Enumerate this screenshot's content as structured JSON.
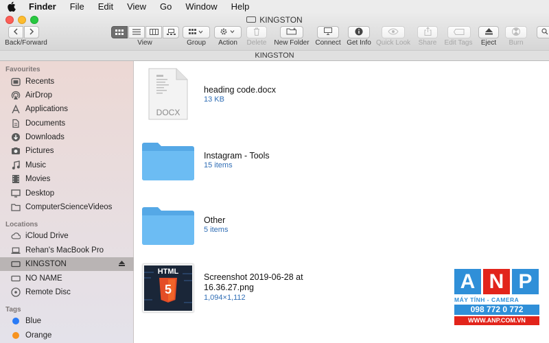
{
  "menubar": {
    "app_name": "Finder",
    "items": [
      "File",
      "Edit",
      "View",
      "Go",
      "Window",
      "Help"
    ]
  },
  "window": {
    "title": "KINGSTON",
    "path_title": "KINGSTON"
  },
  "toolbar": {
    "back_forward_label": "Back/Forward",
    "view_label": "View",
    "group_label": "Group",
    "action_label": "Action",
    "delete_label": "Delete",
    "new_folder_label": "New Folder",
    "connect_label": "Connect",
    "get_info_label": "Get Info",
    "quick_look_label": "Quick Look",
    "share_label": "Share",
    "edit_tags_label": "Edit Tags",
    "eject_label": "Eject",
    "burn_label": "Burn",
    "view_mode_selected": "icon"
  },
  "sidebar": {
    "favourites_header": "Favourites",
    "favourites": [
      {
        "label": "Recents",
        "icon": "recents-icon"
      },
      {
        "label": "AirDrop",
        "icon": "airdrop-icon"
      },
      {
        "label": "Applications",
        "icon": "applications-icon"
      },
      {
        "label": "Documents",
        "icon": "documents-icon"
      },
      {
        "label": "Downloads",
        "icon": "downloads-icon"
      },
      {
        "label": "Pictures",
        "icon": "pictures-icon"
      },
      {
        "label": "Music",
        "icon": "music-icon"
      },
      {
        "label": "Movies",
        "icon": "movies-icon"
      },
      {
        "label": "Desktop",
        "icon": "desktop-icon"
      },
      {
        "label": "ComputerScienceVideos",
        "icon": "folder-icon"
      }
    ],
    "locations_header": "Locations",
    "locations": [
      {
        "label": "iCloud Drive",
        "icon": "cloud-icon"
      },
      {
        "label": "Rehan's MacBook Pro",
        "icon": "laptop-icon"
      },
      {
        "label": "KINGSTON",
        "icon": "drive-icon",
        "selected": true
      },
      {
        "label": "NO NAME",
        "icon": "drive-icon"
      },
      {
        "label": "Remote Disc",
        "icon": "disc-icon"
      }
    ],
    "tags_header": "Tags",
    "tags": [
      {
        "label": "Blue",
        "color": "#2a7bf6"
      },
      {
        "label": "Orange",
        "color": "#f7931e"
      }
    ]
  },
  "files": [
    {
      "name": "heading code.docx",
      "meta": "13 KB",
      "type": "docx",
      "icon_label": "DOCX"
    },
    {
      "name": "Instagram - Tools",
      "meta": "15 items",
      "type": "folder"
    },
    {
      "name": "Other",
      "meta": "5 items",
      "type": "folder"
    },
    {
      "name_line1": "Screenshot 2019-06-28 at",
      "name_line2": "16.36.27.png",
      "meta": "1,094×1,112",
      "type": "png",
      "thumb_label": "HTML",
      "thumb_badge": "5"
    }
  ],
  "watermark": {
    "letters": [
      "A",
      "N",
      "P"
    ],
    "subtitle": "MÁY TÍNH - CAMERA",
    "phone": "098 772 0 772",
    "website": "WWW.ANP.COM.VN"
  },
  "colors": {
    "accent_blue": "#2f6db5",
    "folder_blue": "#5fb4ee",
    "close": "#fc5f57",
    "minimize": "#fdbc2e",
    "maximize": "#28c840"
  }
}
